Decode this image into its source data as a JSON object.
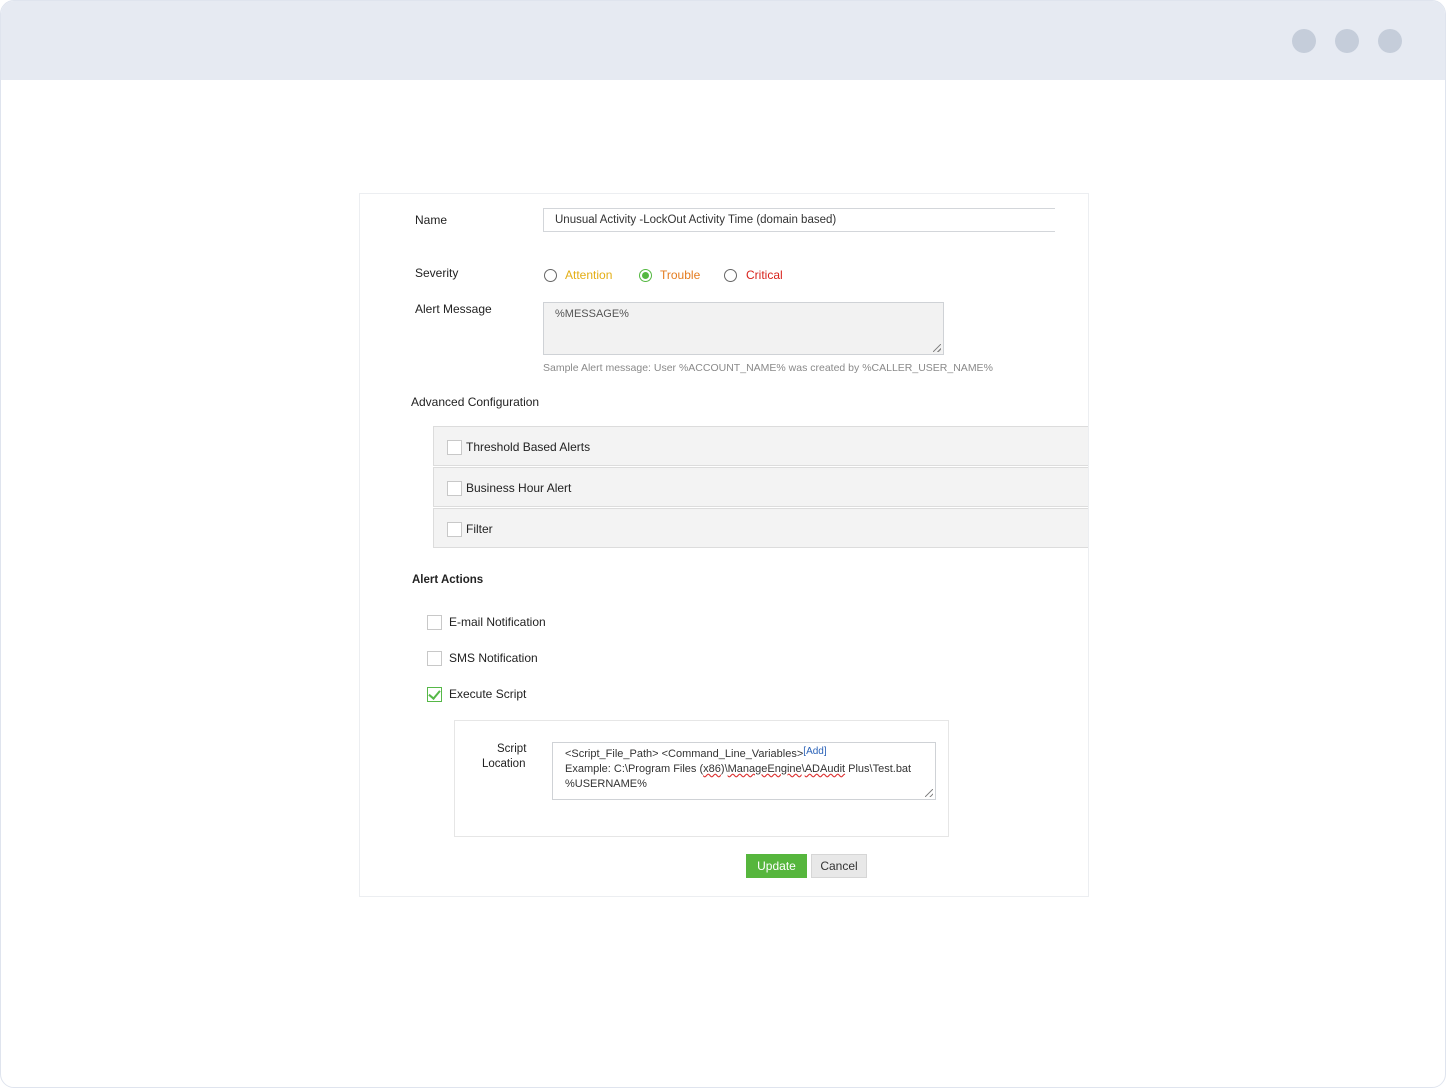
{
  "form": {
    "name_label": "Name",
    "name_value": "Unusual Activity -LockOut Activity Time (domain based)",
    "severity_label": "Severity",
    "severity_options": [
      {
        "label": "Attention",
        "color": "#e3ae16",
        "selected": false
      },
      {
        "label": "Trouble",
        "color": "#e47c20",
        "selected": true
      },
      {
        "label": "Critical",
        "color": "#d8231c",
        "selected": false
      }
    ],
    "alert_message_label": "Alert Message",
    "alert_message_value": "%MESSAGE%",
    "alert_message_hint": "Sample Alert message: User %ACCOUNT_NAME% was created by %CALLER_USER_NAME%",
    "advanced_config_label": "Advanced Configuration",
    "advanced_items": [
      {
        "label": "Threshold Based Alerts",
        "checked": false
      },
      {
        "label": "Business Hour Alert",
        "checked": false
      },
      {
        "label": "Filter",
        "checked": false
      }
    ],
    "alert_actions_label": "Alert Actions",
    "alert_actions": [
      {
        "label": "E-mail Notification",
        "checked": false
      },
      {
        "label": "SMS Notification",
        "checked": false
      },
      {
        "label": "Execute Script",
        "checked": true
      }
    ],
    "script_location_label_1": "Script",
    "script_location_label_2": "Location",
    "script_placeholder_line": "<Script_File_Path> <Command_Line_Variables>",
    "script_add_link": "Add",
    "script_example_prefix": "Example: C:\\Program Files (",
    "script_example_x86": "x86",
    "script_example_sep1": ")\\",
    "script_example_me": "ManageEngine",
    "script_example_sep2": "\\",
    "script_example_ada": "ADAudit",
    "script_example_suffix": " Plus\\Test.bat",
    "script_example_line2": "%USERNAME%",
    "update_label": "Update",
    "cancel_label": "Cancel"
  }
}
